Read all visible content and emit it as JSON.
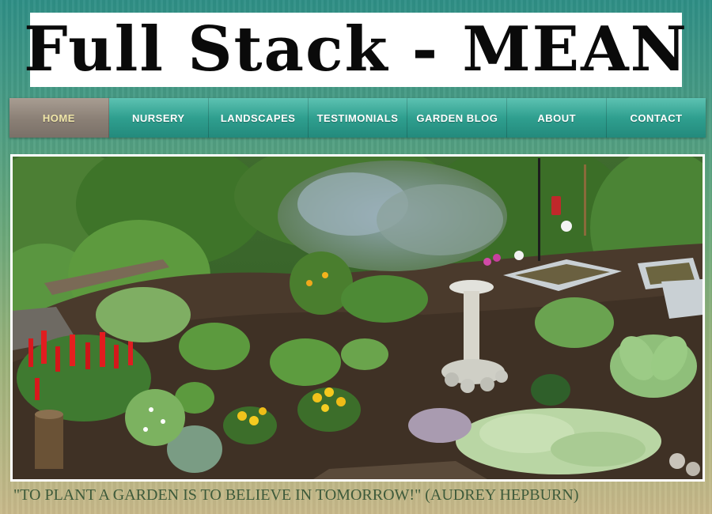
{
  "header": {
    "logo_text": "Full Stack - MEAN"
  },
  "nav": {
    "items": [
      {
        "label": "HOME",
        "active": true
      },
      {
        "label": "NURSERY",
        "active": false
      },
      {
        "label": "LANDSCAPES",
        "active": false
      },
      {
        "label": "TESTIMONIALS",
        "active": false
      },
      {
        "label": "GARDEN BLOG",
        "active": false
      },
      {
        "label": "ABOUT",
        "active": false
      },
      {
        "label": "CONTACT",
        "active": false
      }
    ],
    "colors": {
      "teal": "#2f9f8f",
      "active_bg": "#8a7f75",
      "active_text": "#f0e6a8"
    }
  },
  "hero": {
    "image_semantic": "garden-photo"
  },
  "quote": {
    "text": "\"TO PLANT A GARDEN IS TO BELIEVE IN TOMORROW!\" (AUDREY HEPBURN)"
  }
}
